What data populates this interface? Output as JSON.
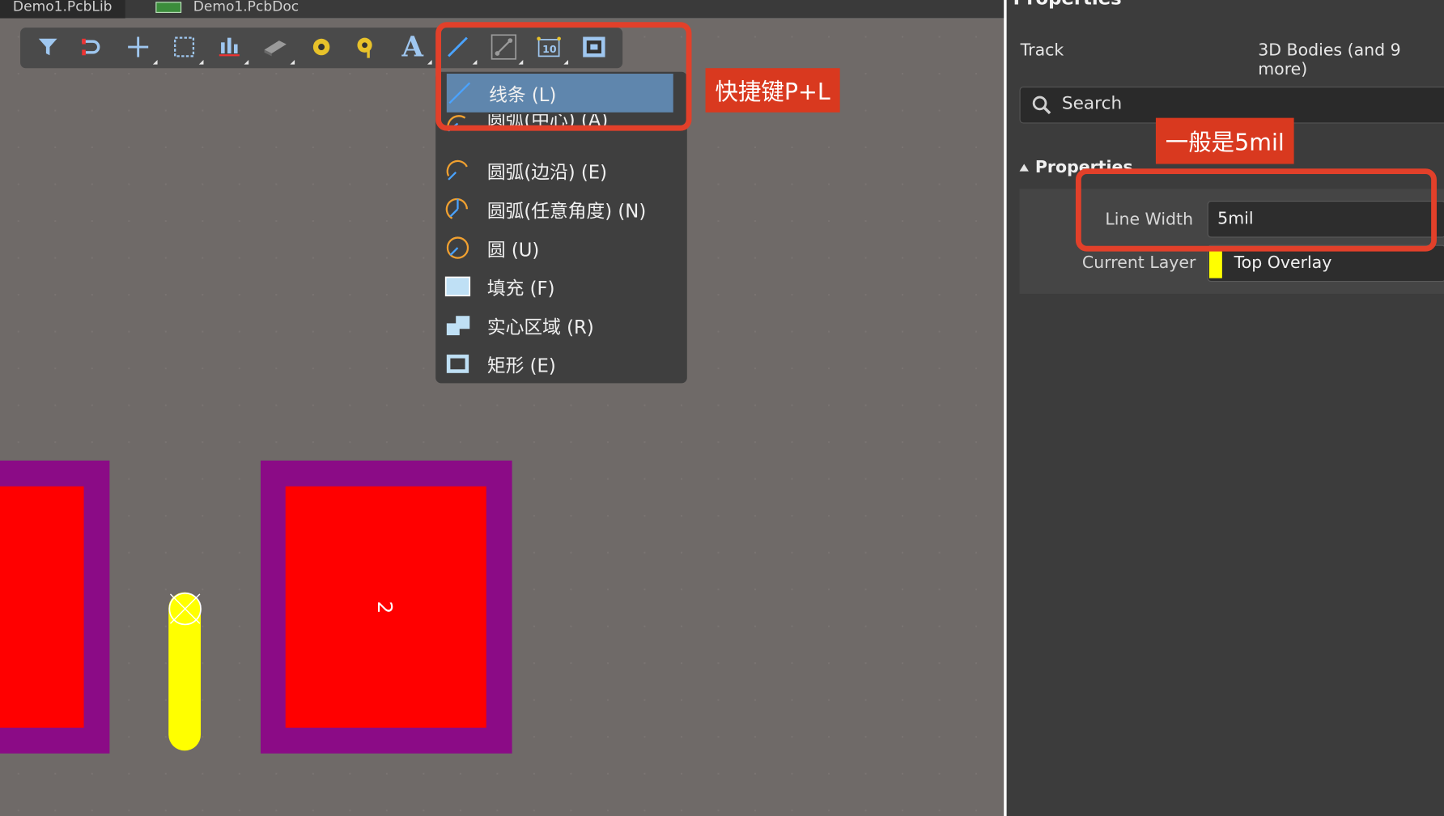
{
  "tabs": [
    {
      "label": "Demo1.PcbLib"
    },
    {
      "label": "Demo1.PcbDoc"
    }
  ],
  "toolbar": {
    "icons": [
      {
        "name": "filter-icon"
      },
      {
        "name": "interactive-routing-icon"
      },
      {
        "name": "crosshair-icon"
      },
      {
        "name": "select-area-icon"
      },
      {
        "name": "align-icon"
      },
      {
        "name": "component-icon"
      },
      {
        "name": "pad-icon"
      },
      {
        "name": "via-icon"
      },
      {
        "name": "text-icon"
      },
      {
        "name": "line-icon"
      },
      {
        "name": "track-icon"
      },
      {
        "name": "dimension-icon"
      },
      {
        "name": "region-icon"
      }
    ]
  },
  "menu": {
    "items": [
      {
        "label": "线条 (L)",
        "icon": "line-icon",
        "selected": true
      },
      {
        "label": "圆弧(中心) (A)",
        "icon": "arc-center-icon",
        "selected": false
      },
      {
        "label": "圆弧(边沿) (E)",
        "icon": "arc-edge-icon",
        "selected": false
      },
      {
        "label": "圆弧(任意角度) (N)",
        "icon": "arc-any-angle-icon",
        "selected": false
      },
      {
        "label": "圆 (U)",
        "icon": "circle-icon",
        "selected": false
      },
      {
        "label": "填充 (F)",
        "icon": "fill-icon",
        "selected": false
      },
      {
        "label": "实心区域 (R)",
        "icon": "solid-region-icon",
        "selected": false
      },
      {
        "label": "矩形 (E)",
        "icon": "rectangle-icon",
        "selected": false
      }
    ]
  },
  "annotations": {
    "shortcut_label": "快捷键P+L",
    "width_label": "一般是5mil"
  },
  "panel": {
    "title": "Properties",
    "object_type": "Track",
    "filter": "3D Bodies (and 9 more)",
    "search_placeholder": "Search",
    "section_title": "Properties",
    "line_width_label": "Line Width",
    "line_width_value": "5mil",
    "current_layer_label": "Current Layer",
    "current_layer_value": "Top Overlay",
    "layer_color": "#ffff00"
  },
  "canvas": {
    "pad_label": "2",
    "colors": {
      "pad": "#ff0000",
      "pad_outline": "#8b0b86",
      "silkscreen": "#ffff00",
      "background": "#6f6a68",
      "accent": "#e2402a"
    }
  }
}
